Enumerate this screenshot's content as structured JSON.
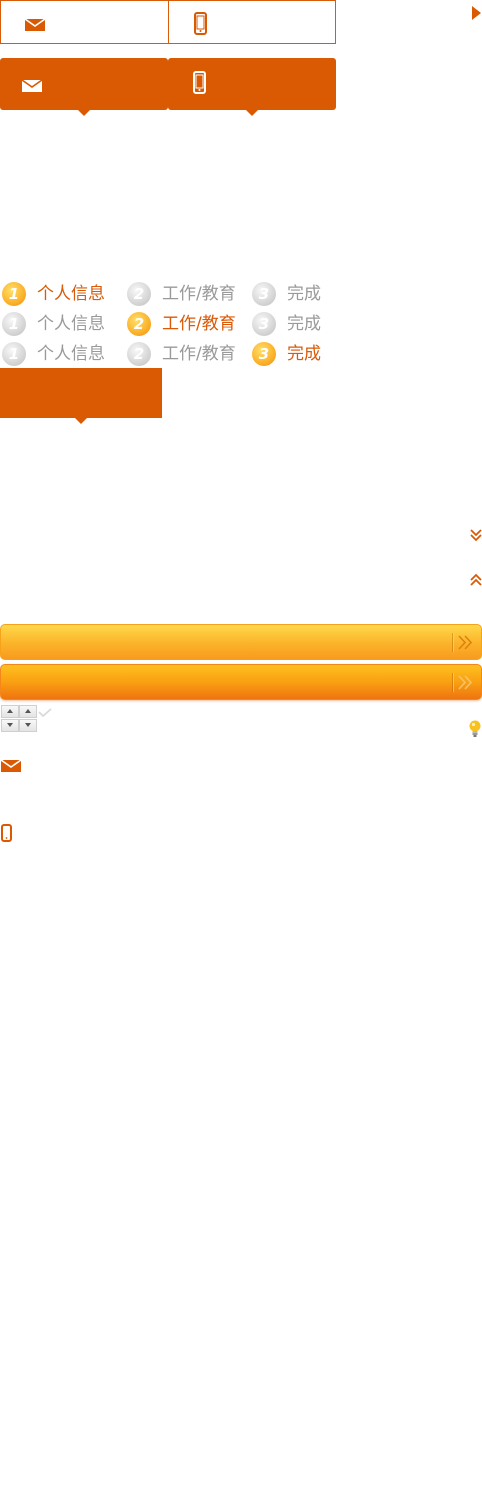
{
  "colors": {
    "accent": "#da5a04",
    "step_active": "#fbb12a",
    "bar_yellow": "#fbb32a",
    "bar_orange": "#f9a012"
  },
  "icons": {
    "mail": "mail-icon",
    "phone": "phone-icon",
    "arrow_right": "caret-right-icon",
    "chevrons_down": "double-chevron-down-icon",
    "chevrons_up": "double-chevron-up-icon",
    "bar_arrow": "double-chevron-right-icon",
    "check": "check-icon",
    "spin_up": "spin-up-icon",
    "spin_down": "spin-down-icon",
    "bulb": "lightbulb-icon"
  },
  "stepper_rows": [
    {
      "steps": [
        {
          "num": "1",
          "label": "个人信息",
          "state": "active"
        },
        {
          "num": "2",
          "label": "工作/教育",
          "state": "inactive"
        },
        {
          "num": "3",
          "label": "完成",
          "state": "inactive"
        }
      ]
    },
    {
      "steps": [
        {
          "num": "1",
          "label": "个人信息",
          "state": "inactive"
        },
        {
          "num": "2",
          "label": "工作/教育",
          "state": "active"
        },
        {
          "num": "3",
          "label": "完成",
          "state": "inactive"
        }
      ]
    },
    {
      "steps": [
        {
          "num": "1",
          "label": "个人信息",
          "state": "inactive"
        },
        {
          "num": "2",
          "label": "工作/教育",
          "state": "inactive"
        },
        {
          "num": "3",
          "label": "完成",
          "state": "active"
        }
      ]
    }
  ]
}
